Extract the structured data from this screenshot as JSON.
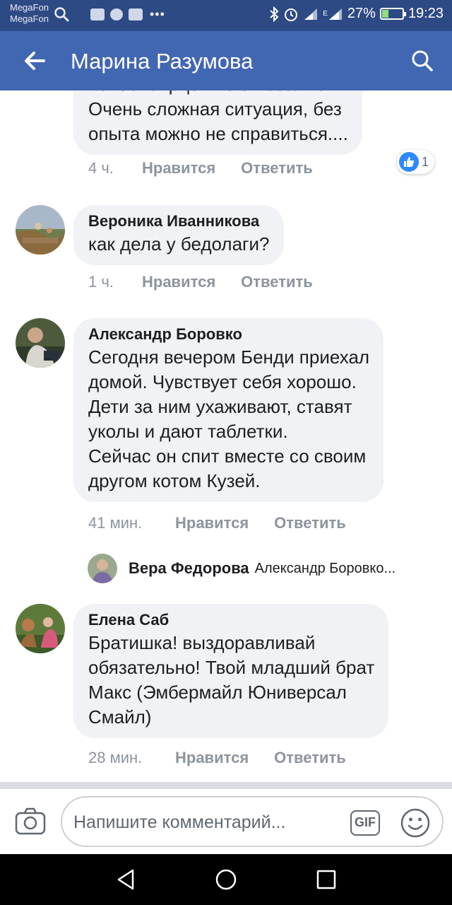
{
  "status_bar": {
    "carrier_1": "MegaFon",
    "carrier_2": "MegaFon",
    "battery": "27%",
    "time": "19:23",
    "network": "E"
  },
  "header": {
    "title": "Марина Разумова",
    "icons": [
      "back-arrow-icon",
      "search-icon"
    ]
  },
  "comments": [
    {
      "author": "",
      "partial_text": "новосибирцев не отказались!",
      "lines": [
        "Очень сложная ситуация, без",
        "опыта можно не справиться...."
      ],
      "time": "4 ч.",
      "like": "Нравится",
      "reply": "Ответить",
      "reaction_count": "1"
    },
    {
      "author": "Вероника Иванникова",
      "lines": [
        "как дела у бедолаги?"
      ],
      "time": "1 ч.",
      "like": "Нравится",
      "reply": "Ответить"
    },
    {
      "author": "Александр Боровко",
      "lines": [
        "Сегодня вечером Бенди приехал",
        "домой. Чувствует себя хорошо.",
        "Дети за ним ухаживают, ставят",
        "уколы и дают таблетки.",
        "Сейчас он спит вместе со своим",
        "другом котом Кузей."
      ],
      "time": "41 мин.",
      "like": "Нравится",
      "reply": "Ответить",
      "reply_preview": {
        "author": "Вера Федорова",
        "text": "Александр Боровко..."
      }
    },
    {
      "author": "Елена Саб",
      "lines": [
        "Братишка! выздоравливай",
        "обязательно! Твой младший брат",
        "Макс (Эмбермайл Юниверсал",
        "Смайл)"
      ],
      "time": "28 мин.",
      "like": "Нравится",
      "reply": "Ответить"
    }
  ],
  "composer": {
    "placeholder": "Напишите комментарий...",
    "gif_label": "GIF"
  },
  "colors": {
    "statusbar": "#2e4a85",
    "appbar": "#4267b2",
    "bubble": "#f0f2f5",
    "meta": "#8d949e",
    "like_blue": "#2e89ff"
  }
}
